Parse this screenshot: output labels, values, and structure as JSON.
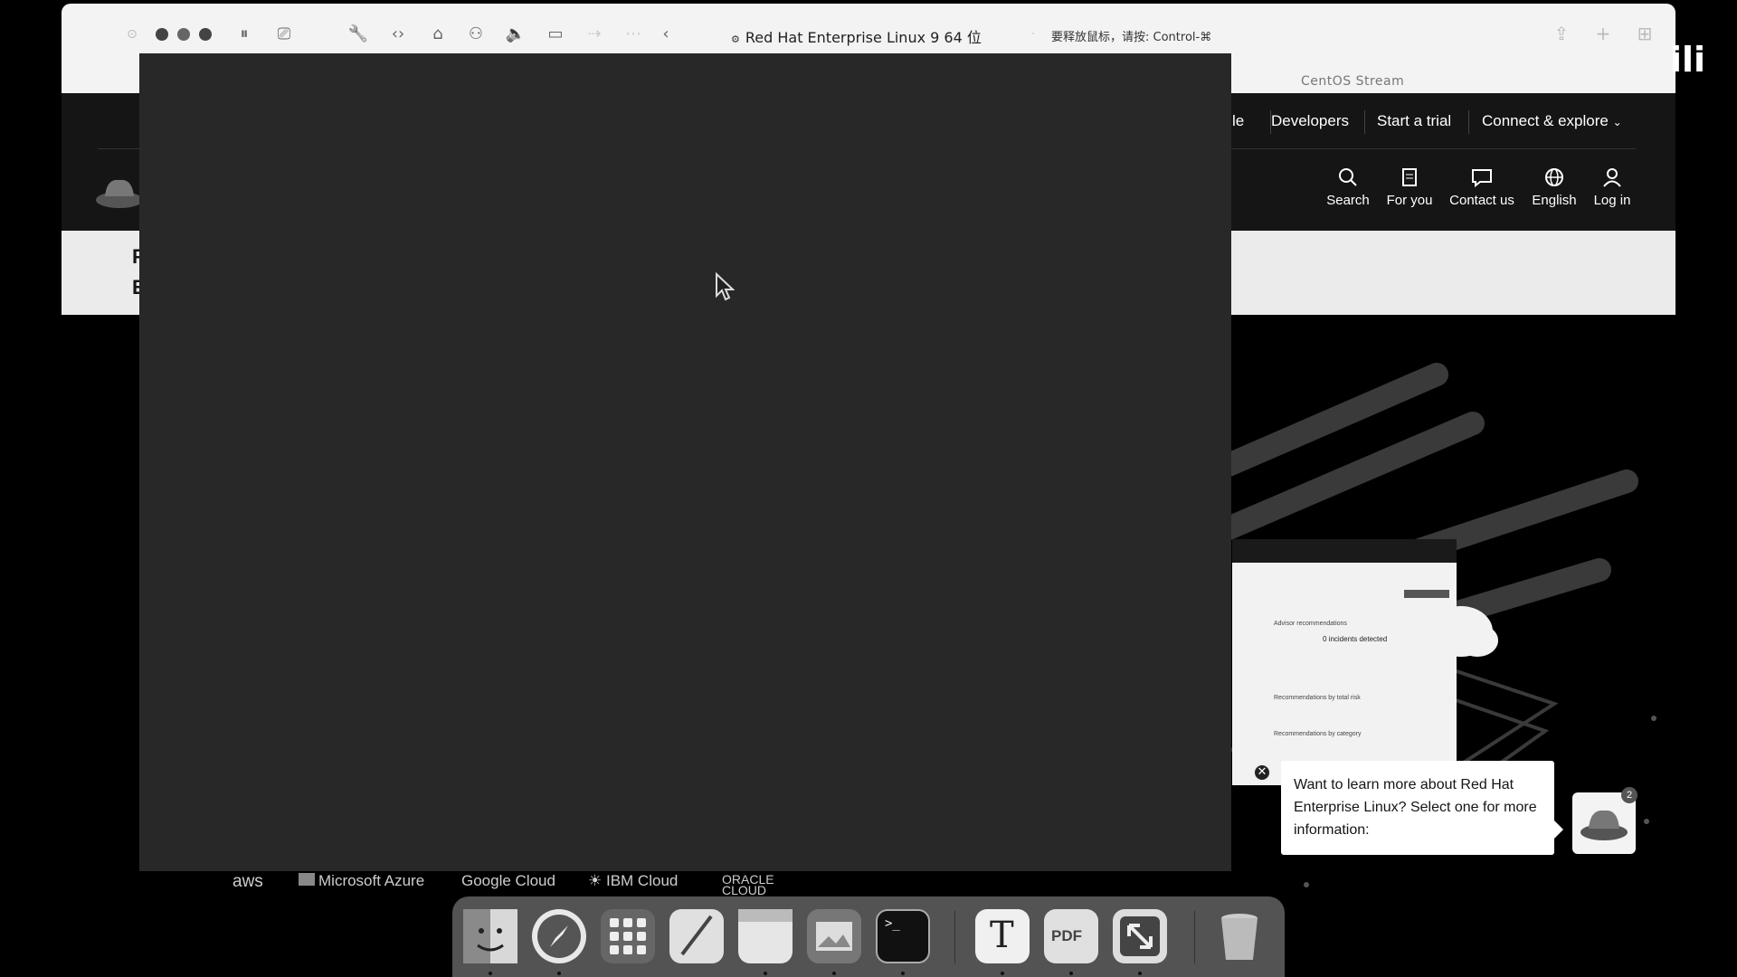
{
  "vm": {
    "title": "Red Hat Enterprise Linux 9 64 位",
    "release_hint": "要释放鼠标，请按: Control-⌘",
    "tab_text": "CentOS Stream"
  },
  "website": {
    "top_links": [
      {
        "label": "le"
      },
      {
        "label": "Developers"
      },
      {
        "label": "Start a trial"
      },
      {
        "label": "Connect & explore"
      }
    ],
    "actions": [
      {
        "label": "Search"
      },
      {
        "label": "For you"
      },
      {
        "label": "Contact us"
      },
      {
        "label": "English"
      },
      {
        "label": "Log in"
      }
    ],
    "band_letters": [
      "F",
      "E"
    ],
    "partners": [
      "aws",
      "Microsoft Azure",
      "Google Cloud",
      "IBM Cloud",
      "ORACLE CLOUD"
    ],
    "dashboard": {
      "line1": "Advisor recommendations",
      "line2": "0 incidents detected",
      "line3": "Recommendations by total risk",
      "line4": "Recommendations by category"
    },
    "chat": {
      "message": "Want to learn more about Red Hat Enterprise Linux? Select one for more information:",
      "badge_count": "2",
      "close_glyph": "✕"
    }
  },
  "dock": {
    "apps": [
      {
        "name": "finder"
      },
      {
        "name": "safari"
      },
      {
        "name": "launchpad"
      },
      {
        "name": "textedit-pen"
      },
      {
        "name": "notes"
      },
      {
        "name": "preview"
      },
      {
        "name": "terminal"
      },
      {
        "name": "typora"
      },
      {
        "name": "pdf-expert"
      },
      {
        "name": "screen-sharing"
      },
      {
        "name": "trash"
      }
    ],
    "terminal_glyph": ">_",
    "typora_glyph": "T",
    "pdf_glyph": "PDF"
  },
  "watermark": "ili"
}
